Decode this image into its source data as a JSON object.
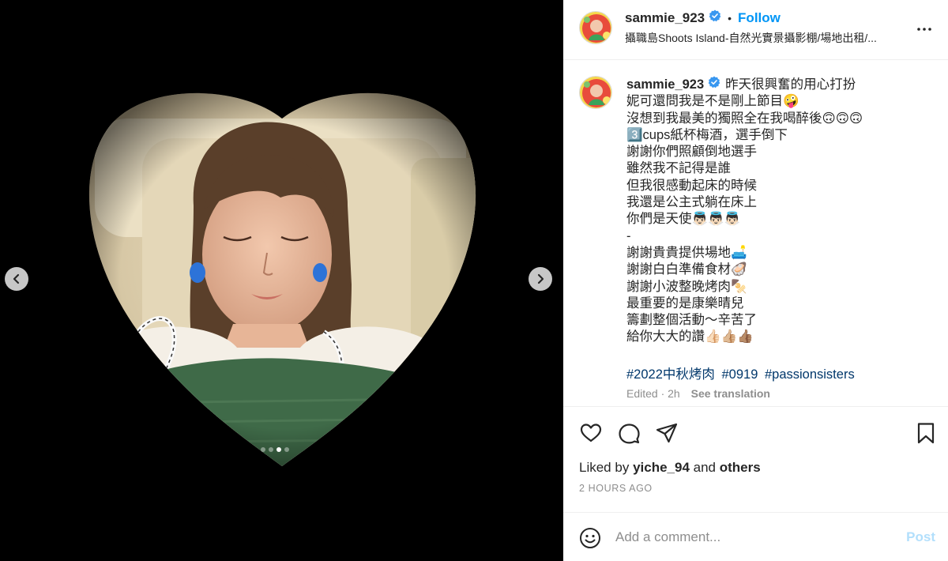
{
  "post": {
    "username": "sammie_923",
    "follow_label": "Follow",
    "separator": "•",
    "location": "攝職島Shoots Island-自然光實景攝影棚/場地出租/...",
    "caption_lines": [
      "昨天很興奮的用心打扮",
      "妮可還問我是不是剛上節目🤪",
      "沒想到我最美的獨照全在我喝醉後🙃🙃🙃",
      "3️⃣cups紙杯梅酒，選手倒下",
      "謝謝你們照顧倒地選手",
      "雖然我不記得是誰",
      "但我很感動起床的時候",
      "我還是公主式躺在床上",
      "你們是天使👼🏻👼🏻👼🏻",
      "-",
      "謝謝貴貴提供場地🛋️",
      "謝謝白白準備食材🦪",
      "謝謝小波整晚烤肉🍢",
      "最重要的是康樂晴兒",
      "籌劃整個活動～辛苦了",
      "給你大大的讚👍🏻👍🏼👍🏽"
    ],
    "hashtags": [
      "#2022中秋烤肉",
      "#0919",
      "#passionsisters"
    ],
    "edited": "Edited · 2h",
    "see_translation": "See translation",
    "liked_by_prefix": "Liked by",
    "liked_by_user": "yiche_94",
    "liked_by_and": "and",
    "liked_by_others": "others",
    "time_ago": "2 HOURS AGO"
  },
  "comment": {
    "placeholder": "Add a comment...",
    "post_label": "Post"
  },
  "media": {
    "slide_count": 4,
    "active_slide": 3
  },
  "colors": {
    "accent": "#0095f6",
    "verified": "#3897f0",
    "hashtag": "#00376b",
    "post_disabled": "#b2dffc"
  }
}
